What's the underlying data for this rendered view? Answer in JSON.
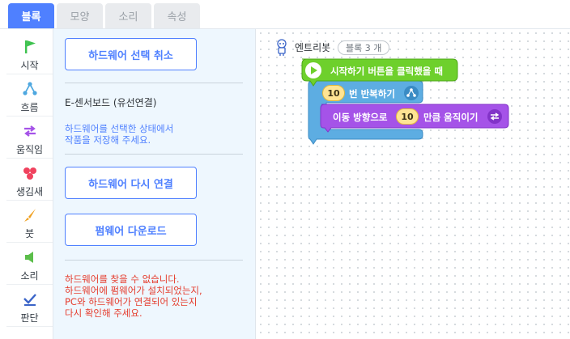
{
  "tabs": [
    {
      "label": "블록",
      "active": true
    },
    {
      "label": "모양",
      "active": false
    },
    {
      "label": "소리",
      "active": false
    },
    {
      "label": "속성",
      "active": false
    }
  ],
  "categories": [
    {
      "label": "시작",
      "icon": "flag-icon"
    },
    {
      "label": "흐름",
      "icon": "flow-icon"
    },
    {
      "label": "움직임",
      "icon": "arrows-icon"
    },
    {
      "label": "생김새",
      "icon": "shapes-icon"
    },
    {
      "label": "붓",
      "icon": "brush-icon"
    },
    {
      "label": "소리",
      "icon": "speaker-icon"
    },
    {
      "label": "판단",
      "icon": "check-icon"
    }
  ],
  "hardware": {
    "cancel_button": "하드웨어 선택 취소",
    "device_name": "E-센서보드 (유선연결)",
    "save_hint_1": "하드웨어를 선택한 상태에서",
    "save_hint_2": "작품을 저장해 주세요.",
    "reconnect_button": "하드웨어 다시 연결",
    "firmware_button": "펌웨어 다운로드",
    "error_1": "하드웨어를 찾을 수 없습니다.",
    "error_2": "하드웨어에 펌웨어가 설치되었는지,",
    "error_3": "PC와 하드웨어가 연결되어 있는지",
    "error_4": "다시 확인해 주세요."
  },
  "canvas": {
    "object_name": "엔트리봇",
    "block_count": "블록 3 개",
    "start_block": "시작하기 버튼을 클릭했을 때",
    "repeat_count": "10",
    "repeat_label": "번 반복하기",
    "move_prefix": "이동 방향으로",
    "move_value": "10",
    "move_suffix": "만큼 움직이기"
  },
  "colors": {
    "accent": "#4f80ff",
    "start_block": "#6ed02c",
    "flow_block": "#5dade2",
    "motion_block": "#a553e8",
    "panel_bg": "#eef7fe",
    "error": "#e53b2c"
  }
}
